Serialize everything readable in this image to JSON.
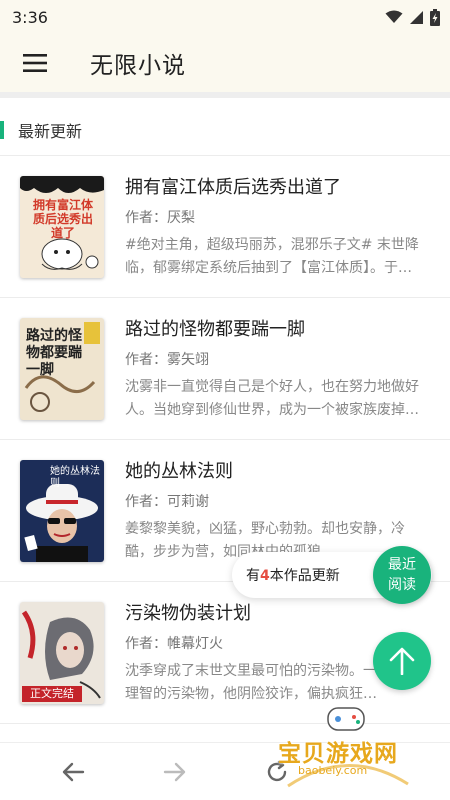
{
  "status": {
    "time": "3:36"
  },
  "appbar": {
    "title": "无限小说"
  },
  "section": {
    "title": "最新更新"
  },
  "books": [
    {
      "title": "拥有富江体质后选秀出道了",
      "author": "作者：厌梨",
      "desc": "#绝对主角，超级玛丽苏，混邪乐子文# 末世降临，郁雾绑定系统后抽到了【富江体质】。于…",
      "cover_text": "拥有富江体质后选秀出道了",
      "cover_bg": "#f4e9d7"
    },
    {
      "title": "路过的怪物都要踹一脚",
      "author": "作者：雾矢翊",
      "desc": "沈雾非一直觉得自己是个好人，也在努力地做好人。当她穿到修仙世界，成为一个被家族废掉…",
      "cover_text": "路过的怪物都要踹一脚",
      "cover_bg": "#efe4cf"
    },
    {
      "title": "她的丛林法则",
      "author": "作者：可莉谢",
      "desc": "姜黎黎美貌，凶猛，野心勃勃。却也安静，冷酷，步步为营，如同林中的孤狼…",
      "cover_text": "她的丛林法则",
      "cover_bg": "#1c2d58"
    },
    {
      "title": "污染物伪装计划",
      "author": "作者：帷幕灯火",
      "desc": "沈季穿成了末世文里最可怕的污染物。一个拥有理智的污染物，他阴险狡诈，偏执疯狂…",
      "cover_text": "污染物伪装计划",
      "cover_badge": "正文完结",
      "cover_bg": "#ece6dd"
    }
  ],
  "toast": {
    "prefix": "有",
    "count": "4",
    "suffix": "本作品更新"
  },
  "recent_button": {
    "line1": "最近",
    "line2": "阅读"
  },
  "watermark": {
    "text": "宝贝游戏网",
    "url": "baobeiy.com"
  },
  "colors": {
    "accent": "#19b37c",
    "highlight": "#e54d42"
  },
  "icons": [
    "menu-icon",
    "wifi-icon",
    "signal-icon",
    "battery-icon",
    "arrow-up-icon",
    "back-arrow-icon",
    "forward-arrow-icon",
    "refresh-icon"
  ]
}
